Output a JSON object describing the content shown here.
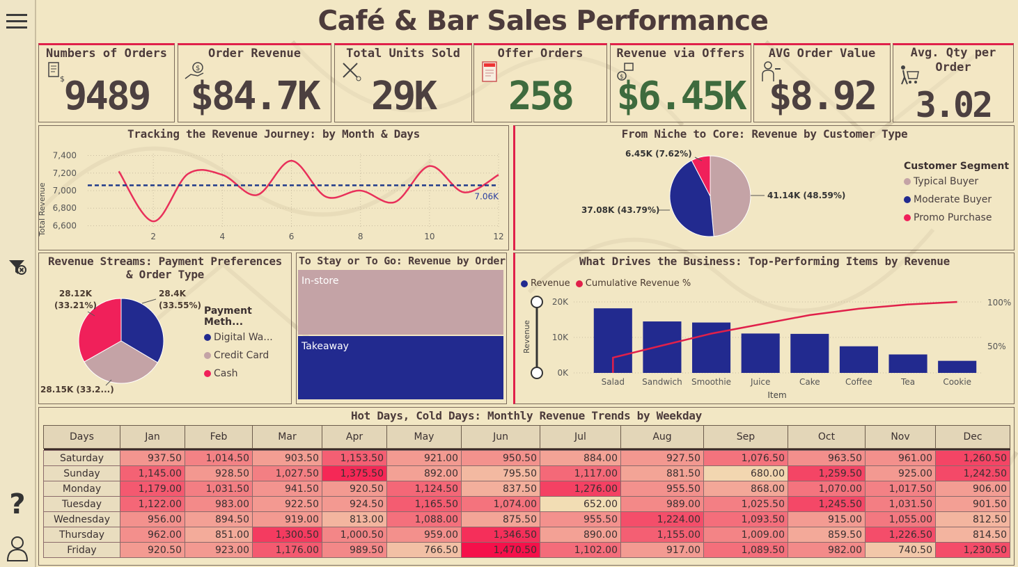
{
  "title": "Café & Bar Sales Performance",
  "kpis": [
    {
      "label": "Numbers of Orders",
      "value": "9489",
      "icon": "receipt-icon"
    },
    {
      "label": "Order Revenue",
      "value": "$84.7K",
      "icon": "money-hand-icon"
    },
    {
      "label": "Total Units Sold",
      "value": "29K",
      "icon": "tools-icon"
    },
    {
      "label": "Offer Orders",
      "value": "258",
      "icon": "offer-tag-icon"
    },
    {
      "label": "Revenue via Offers",
      "value": "$6.45K",
      "icon": "coins-box-icon"
    },
    {
      "label": "AVG Order Value",
      "value": "$8.92",
      "icon": "waiter-icon"
    },
    {
      "label": "Avg. Qty per\nOrder",
      "value": "3.02",
      "icon": "cart-person-icon"
    }
  ],
  "line_panel": {
    "title": "Tracking the Revenue Journey: by Month & Days",
    "ylabel": "Total Revenue",
    "avg_label": "7.06K"
  },
  "customer_panel": {
    "title": "From Niche to Core: Revenue by Customer Type",
    "legend_title": "Customer Segment",
    "legend": [
      "Typical Buyer",
      "Moderate Buyer",
      "Promo Purchase"
    ],
    "labels": [
      "41.14K (48.59%)",
      "37.08K (43.79%)",
      "6.45K (7.62%)"
    ]
  },
  "payment_panel": {
    "title": "Revenue Streams: Payment Preferences & Order Type",
    "legend_title": "Payment Meth...",
    "legend": [
      "Digital Wa...",
      "Credit Card",
      "Cash"
    ],
    "labels": [
      "28.4K\n(33.55%)",
      "28.15K (33.2...)",
      "28.12K\n(33.21%)"
    ]
  },
  "ordertype_panel": {
    "title": "To Stay or To Go: Revenue by Order Type",
    "tiles": [
      "In-store",
      "Takeaway"
    ]
  },
  "items_panel": {
    "title": "What Drives the Business: Top-Performing Items by Revenue",
    "legend": [
      "Revenue",
      "Cumulative Revenue %"
    ],
    "ylabel": "Revenue",
    "xlabel": "Item",
    "y_ticks": [
      "0K",
      "10K",
      "20K"
    ],
    "y2_ticks": [
      "50%",
      "100%"
    ]
  },
  "heatmap": {
    "title": "Hot Days, Cold Days: Monthly Revenue Trends by Weekday",
    "corner": "Days",
    "months": [
      "Jan",
      "Feb",
      "Mar",
      "Apr",
      "May",
      "Jun",
      "Jul",
      "Aug",
      "Sep",
      "Oct",
      "Nov",
      "Dec"
    ],
    "rows": [
      {
        "day": "Saturday",
        "values": [
          "937.50",
          "1,014.50",
          "903.50",
          "1,153.50",
          "921.00",
          "950.50",
          "884.00",
          "927.50",
          "1,076.50",
          "963.50",
          "961.00",
          "1,260.50"
        ]
      },
      {
        "day": "Sunday",
        "values": [
          "1,145.00",
          "928.50",
          "1,027.50",
          "1,375.50",
          "892.00",
          "795.50",
          "1,117.00",
          "881.50",
          "680.00",
          "1,259.50",
          "925.00",
          "1,242.50"
        ]
      },
      {
        "day": "Monday",
        "values": [
          "1,179.00",
          "1,031.50",
          "941.50",
          "920.50",
          "1,124.50",
          "837.50",
          "1,276.00",
          "955.50",
          "868.00",
          "1,070.00",
          "1,017.50",
          "906.00"
        ]
      },
      {
        "day": "Tuesday",
        "values": [
          "1,122.00",
          "983.00",
          "922.50",
          "924.50",
          "1,165.50",
          "1,074.00",
          "652.00",
          "989.00",
          "1,025.50",
          "1,245.50",
          "1,031.50",
          "901.50"
        ]
      },
      {
        "day": "Wednesday",
        "values": [
          "956.00",
          "894.50",
          "919.00",
          "813.00",
          "1,088.00",
          "875.50",
          "955.50",
          "1,224.00",
          "1,093.50",
          "915.00",
          "1,055.00",
          "812.50"
        ]
      },
      {
        "day": "Thursday",
        "values": [
          "962.00",
          "851.00",
          "1,300.50",
          "1,000.50",
          "959.00",
          "1,346.50",
          "890.00",
          "1,155.00",
          "1,009.00",
          "859.50",
          "1,226.50",
          "814.50"
        ]
      },
      {
        "day": "Friday",
        "values": [
          "920.50",
          "923.00",
          "1,176.00",
          "989.50",
          "766.50",
          "1,470.50",
          "1,102.00",
          "917.00",
          "1,089.50",
          "982.00",
          "740.50",
          "1,230.50"
        ]
      }
    ]
  },
  "colors": {
    "accent": "#e0204a",
    "navy": "#222a8f",
    "rose": "#c4a3a6",
    "pink": "#f0205a",
    "green": "#3e6b3e"
  },
  "chart_data": [
    {
      "type": "line",
      "x": [
        1,
        2,
        3,
        4,
        5,
        6,
        7,
        8,
        9,
        10,
        11,
        12
      ],
      "series": [
        {
          "values": [
            7220,
            6650,
            7190,
            7180,
            6950,
            7340,
            6930,
            7000,
            6870,
            7280,
            6980,
            7180
          ]
        }
      ],
      "avg": 7060,
      "ylabel": "Total Revenue",
      "x_ticks": [
        2,
        4,
        6,
        8,
        10,
        12
      ],
      "y_ticks": [
        "6,600",
        "6,800",
        "7,000",
        "7,200",
        "7,400"
      ],
      "ylim": [
        6580,
        7420
      ],
      "xlim": [
        0.1,
        12
      ]
    },
    {
      "type": "pie",
      "categories": [
        "Typical Buyer",
        "Moderate Buyer",
        "Promo Purchase"
      ],
      "values": [
        48.59,
        43.79,
        7.62
      ],
      "colors": [
        "#c4a3a6",
        "#222a8f",
        "#f0205a"
      ]
    },
    {
      "type": "pie",
      "categories": [
        "Digital Wa...",
        "Credit Card",
        "Cash"
      ],
      "values": [
        33.55,
        33.24,
        33.21
      ],
      "colors": [
        "#222a8f",
        "#c4a3a6",
        "#f0205a"
      ]
    },
    {
      "type": "bar",
      "categories": [
        "Salad",
        "Sandwich",
        "Smoothie",
        "Juice",
        "Cake",
        "Coffee",
        "Tea",
        "Cookie"
      ],
      "values": [
        18200,
        14500,
        14200,
        11100,
        11000,
        7500,
        5200,
        3400
      ],
      "cumulative_pct": [
        21.5,
        38.6,
        55.4,
        68.5,
        81.5,
        90.4,
        96.5,
        100
      ],
      "ylim": [
        0,
        20000
      ],
      "xlabel": "Item",
      "ylabel": "Revenue"
    }
  ]
}
